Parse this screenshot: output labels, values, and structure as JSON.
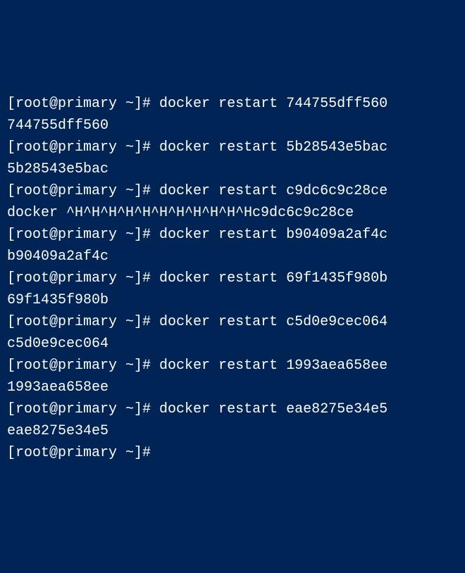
{
  "terminal": {
    "prompt": "[root@primary ~]# ",
    "entries": [
      {
        "command": "docker restart 744755dff560",
        "output": "744755dff560"
      },
      {
        "command": "docker restart 5b28543e5bac",
        "output": "5b28543e5bac"
      },
      {
        "command": "docker restart c9dc6c9c28ce",
        "output": "docker ^H^H^H^H^H^H^H^H^H^H^Hc9dc6c9c28ce"
      },
      {
        "command": "docker restart b90409a2af4c",
        "output": "b90409a2af4c"
      },
      {
        "command": "docker restart 69f1435f980b",
        "output": "69f1435f980b"
      },
      {
        "command": "docker restart c5d0e9cec064",
        "output": "c5d0e9cec064"
      },
      {
        "command": "docker restart 1993aea658ee",
        "output": "1993aea658ee"
      },
      {
        "command": "docker restart eae8275e34e5",
        "output": "eae8275e34e5"
      }
    ],
    "final_prompt": "[root@primary ~]#"
  }
}
